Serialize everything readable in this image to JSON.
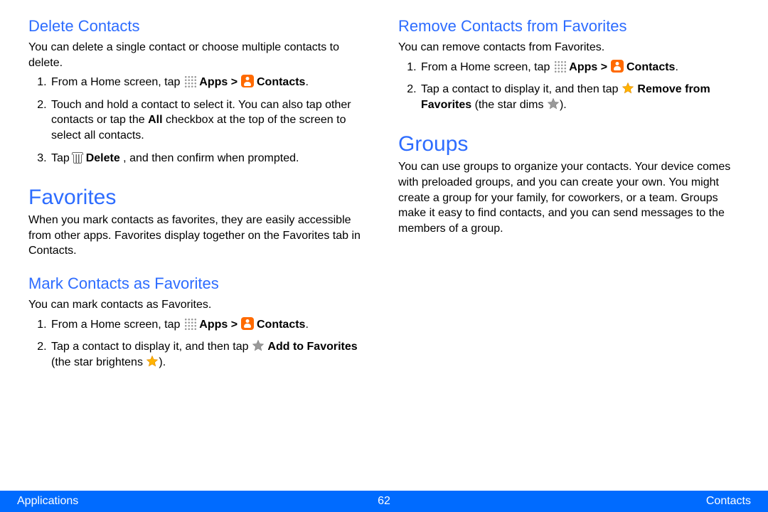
{
  "left": {
    "delete": {
      "heading": "Delete Contacts",
      "intro": "You can delete a single contact or choose multiple contacts to delete.",
      "s1_a": "From a Home screen, tap ",
      "s1_apps": "Apps > ",
      "s1_contacts": "Contacts",
      "s1_end": ".",
      "s2_a": "Touch and hold a contact to select it. You can also tap other contacts or tap the ",
      "s2_all": "All",
      "s2_b": " checkbox at the top of the screen to select all contacts.",
      "s3_a": "Tap ",
      "s3_delete": "Delete",
      "s3_b": " , and then confirm when prompted."
    },
    "favorites": {
      "heading": "Favorites",
      "intro": "When you mark contacts as favorites, they are easily accessible from other apps. Favorites display together on the Favorites tab in Contacts."
    },
    "mark": {
      "heading": "Mark Contacts as Favorites",
      "intro": "You can mark contacts as Favorites.",
      "s1_a": "From a Home screen, tap ",
      "s1_apps": " Apps > ",
      "s1_contacts": "Contacts",
      "s1_end": ".",
      "s2_a": "Tap a contact to display it, and then tap ",
      "s2_add": "Add to Favorites",
      "s2_b": " (the star brightens ",
      "s2_end": ")."
    }
  },
  "right": {
    "remove": {
      "heading": "Remove Contacts from Favorites",
      "intro": "You can remove contacts from Favorites.",
      "s1_a": "From a Home screen, tap ",
      "s1_apps": "Apps > ",
      "s1_contacts": "Contacts",
      "s1_end": ".",
      "s2_a": "Tap a contact to display it, and then tap ",
      "s2_remove": "Remove from Favorites",
      "s2_b": " (the star dims ",
      "s2_end": ")."
    },
    "groups": {
      "heading": "Groups",
      "intro": "You can use groups to organize your contacts. Your device comes with preloaded groups, and you can create your own. You might create a group for your family, for coworkers, or a team. Groups make it easy to find contacts, and you can send messages to the members of a group."
    }
  },
  "footer": {
    "left": "Applications",
    "page": "62",
    "right": "Contacts"
  },
  "icons": {
    "apps": "apps-grid",
    "contacts": "contacts-person",
    "trash": "trash-can",
    "star_gray": "#9a9a9a",
    "star_orange": "#ffb300"
  }
}
